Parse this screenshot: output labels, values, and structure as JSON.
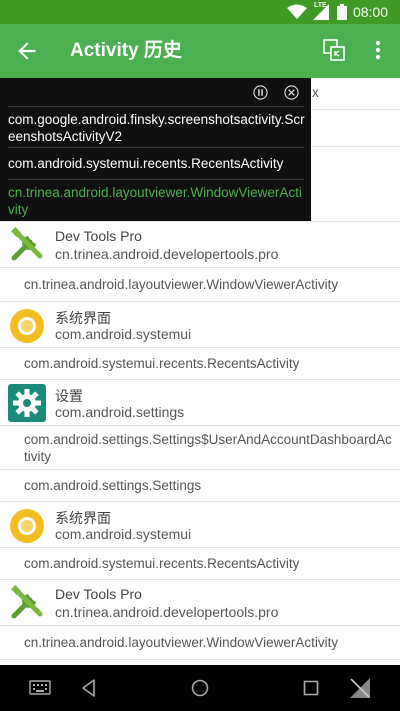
{
  "status_bar": {
    "time": "08:00",
    "lte_label": "LTE",
    "icons": [
      "wifi-icon",
      "signal-icon",
      "battery-icon"
    ]
  },
  "app_bar": {
    "title": "Activity 历史",
    "back_icon": "arrow-back-icon",
    "actions": [
      "layout-viewer-icon",
      "more-vert-icon"
    ]
  },
  "colors": {
    "status_bar": "#3f9a25",
    "app_bar": "#4caf50",
    "accent_green": "#4caf50",
    "settings_teal": "#1b8a78",
    "systemui_yellow": "#f2bd22"
  },
  "list": {
    "partial_top_suffix": "x",
    "rows": [
      {
        "kind": "app",
        "name": "Dev Tools Pro",
        "package": "cn.trinea.android.developertools.pro",
        "icon": "dev-tools-icon"
      },
      {
        "kind": "activity",
        "text": "cn.trinea.android.layoutviewer.WindowViewerActivity"
      },
      {
        "kind": "app",
        "name": "系统界面",
        "package": "com.android.systemui",
        "icon": "systemui-icon"
      },
      {
        "kind": "activity",
        "text": "com.android.systemui.recents.RecentsActivity"
      },
      {
        "kind": "app",
        "name": "设置",
        "package": "com.android.settings",
        "icon": "settings-gear-icon"
      },
      {
        "kind": "activity",
        "text": "com.android.settings.Settings$UserAndAccountDashboardActivity"
      },
      {
        "kind": "activity",
        "text": "com.android.settings.Settings"
      },
      {
        "kind": "app",
        "name": "系统界面",
        "package": "com.android.systemui",
        "icon": "systemui-icon"
      },
      {
        "kind": "activity",
        "text": "com.android.systemui.recents.RecentsActivity"
      },
      {
        "kind": "app",
        "name": "Dev Tools Pro",
        "package": "cn.trinea.android.developertools.pro",
        "icon": "dev-tools-icon"
      },
      {
        "kind": "activity",
        "text": "cn.trinea.android.layoutviewer.WindowViewerActivity"
      }
    ]
  },
  "overlay": {
    "controls": [
      "pause-icon",
      "close-icon"
    ],
    "items": [
      "com.google.android.finsky.screenshotsactivity.ScreenshotsActivityV2",
      "com.android.systemui.recents.RecentsActivity",
      "cn.trinea.android.layoutviewer.WindowViewerActivity"
    ]
  },
  "nav_bar": {
    "icons": [
      "keyboard-icon",
      "back-triangle-icon",
      "home-circle-icon",
      "recents-square-icon",
      "rotate-icon"
    ]
  }
}
